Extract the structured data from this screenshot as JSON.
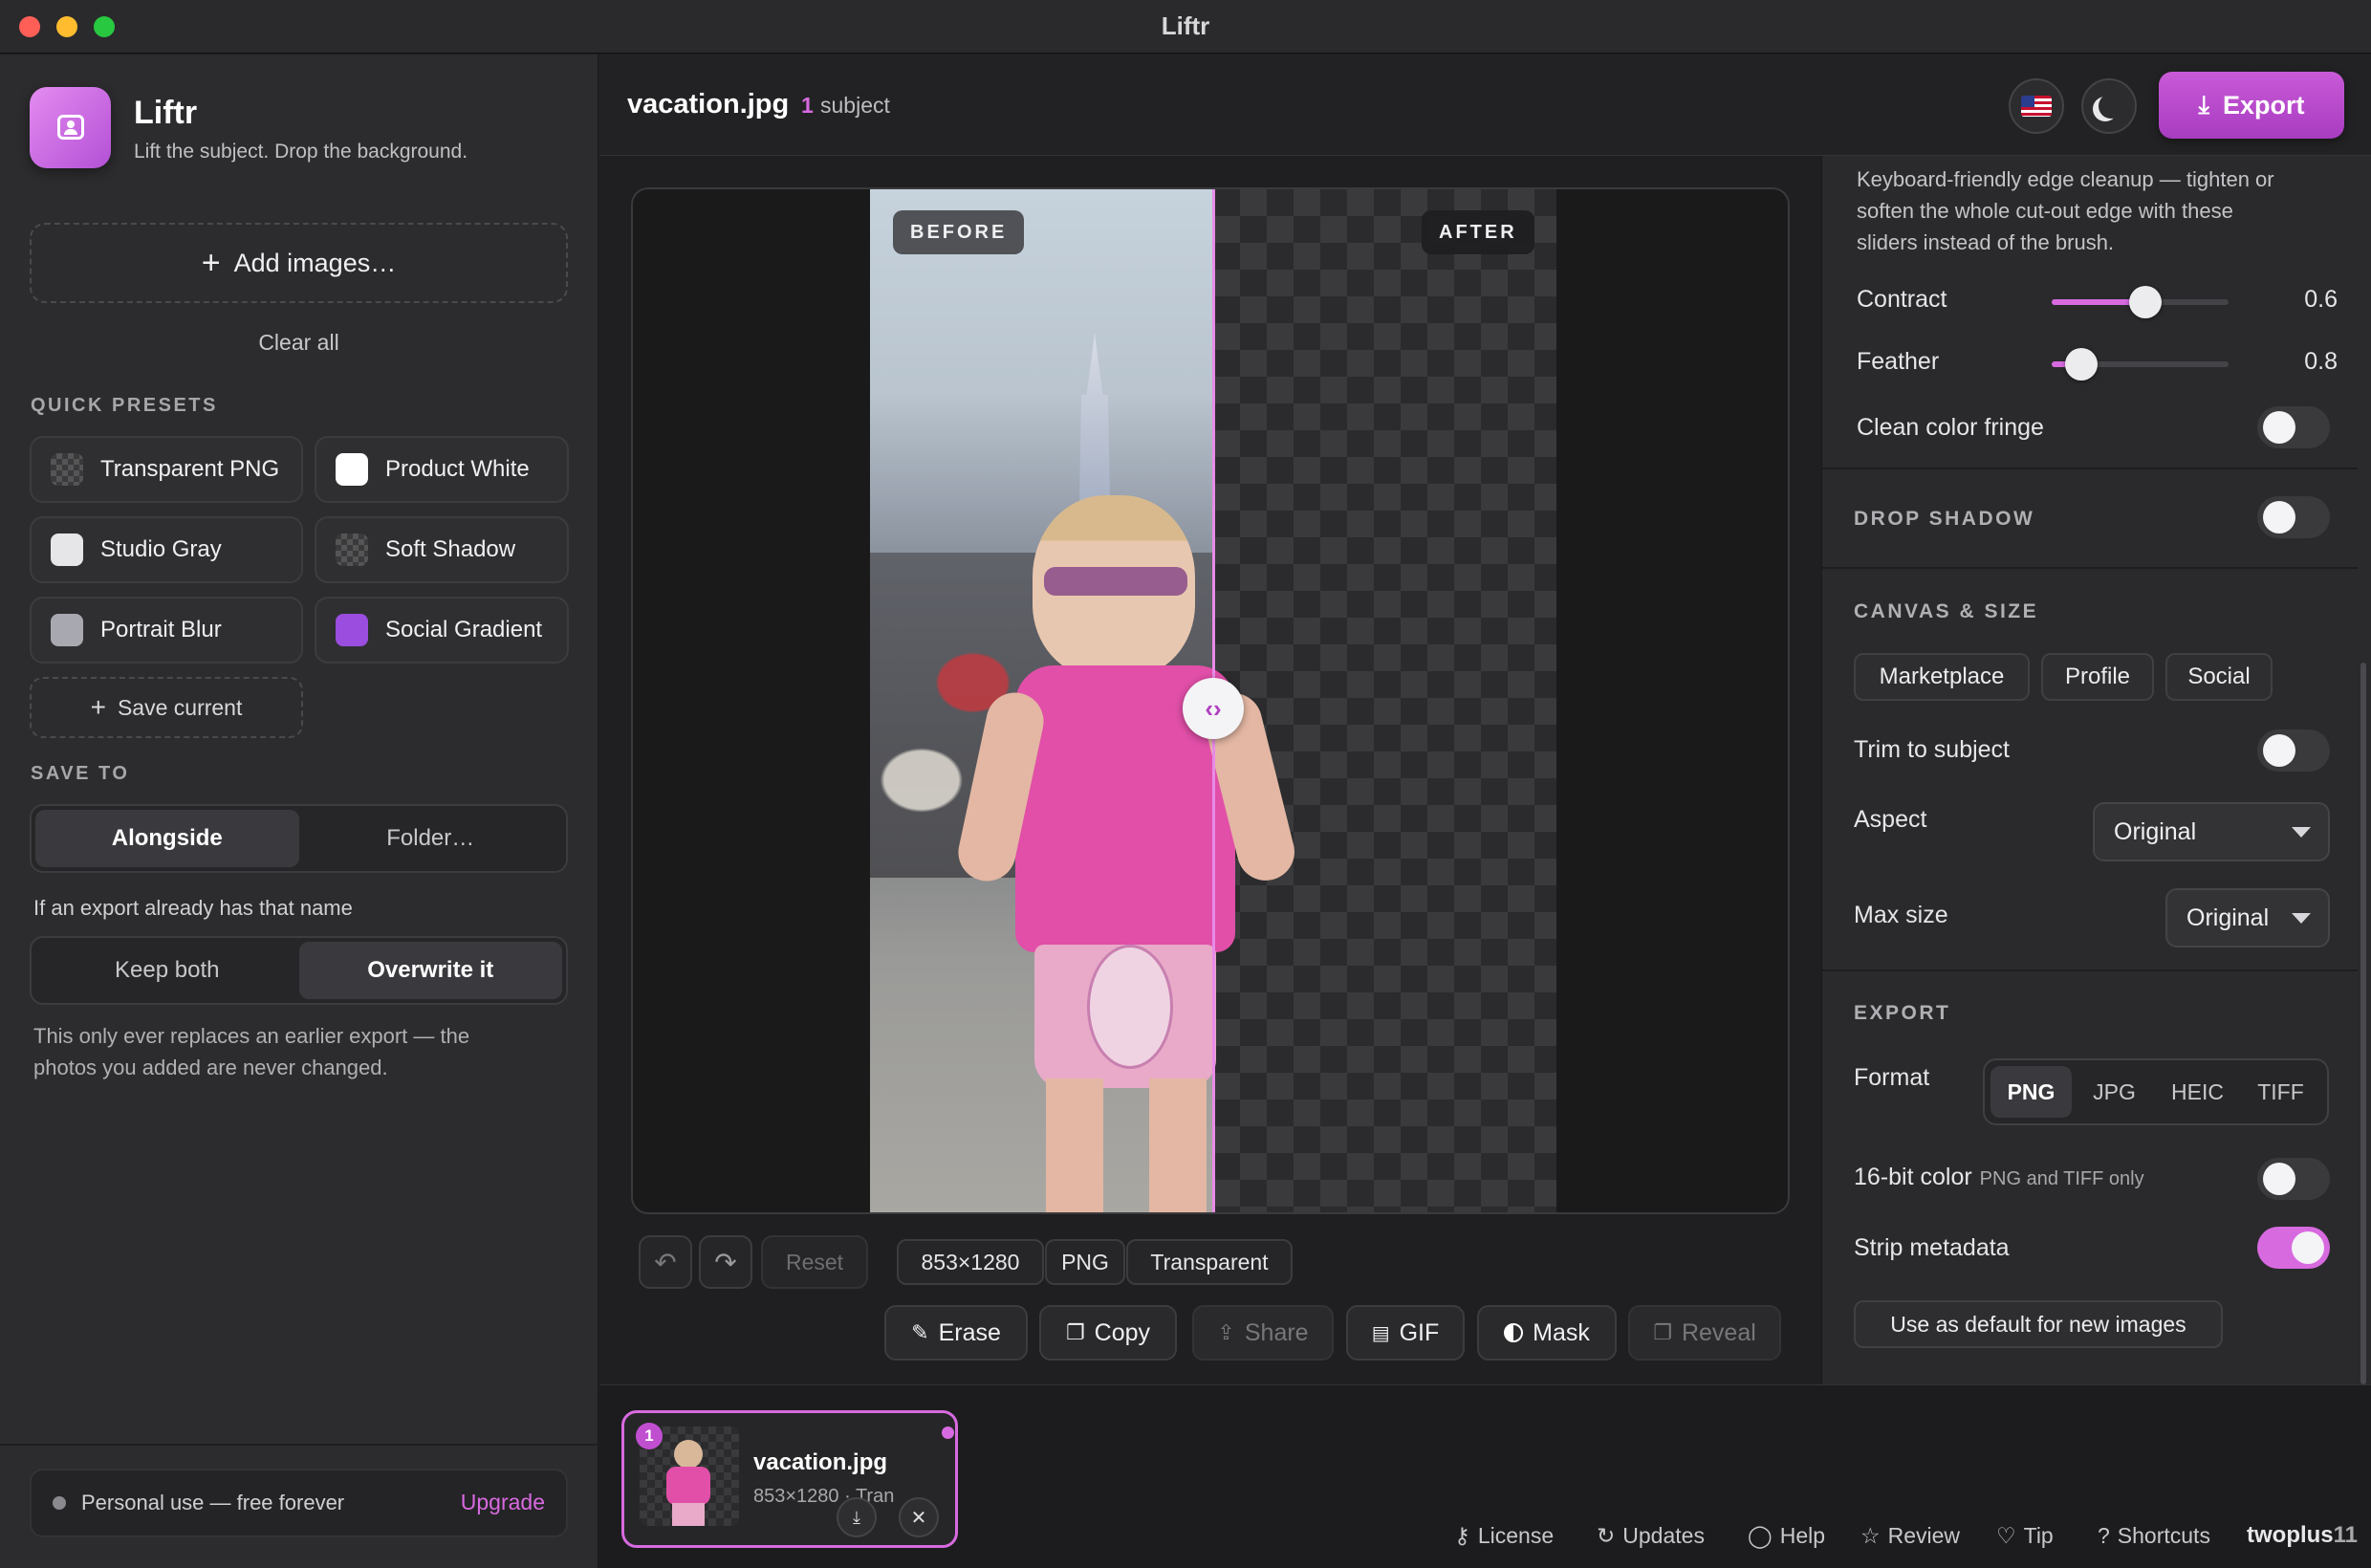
{
  "window": {
    "title": "Liftr"
  },
  "sidebar": {
    "app_name": "Liftr",
    "tagline": "Lift the subject. Drop the background.",
    "add_images": "Add images…",
    "clear_all": "Clear all",
    "quick_presets_label": "QUICK PRESETS",
    "presets": [
      {
        "label": "Transparent PNG",
        "swatch": "checker"
      },
      {
        "label": "Product White",
        "swatch": "#ffffff"
      },
      {
        "label": "Studio Gray",
        "swatch": "#e6e6e8"
      },
      {
        "label": "Soft Shadow",
        "swatch": "checker"
      },
      {
        "label": "Portrait Blur",
        "swatch": "#a8a8b0"
      },
      {
        "label": "Social Gradient",
        "swatch": "#9b4de0"
      }
    ],
    "save_current": "Save current",
    "save_to_label": "SAVE TO",
    "save_to": {
      "alongside": "Alongside",
      "folder": "Folder…",
      "selected": "Alongside"
    },
    "conflict_label": "If an export already has that name",
    "conflict": {
      "keep_both": "Keep both",
      "overwrite": "Overwrite it",
      "selected": "Overwrite it"
    },
    "conflict_note_1": "This only ever replaces an earlier export — the",
    "conflict_note_2": "photos you added are never changed.",
    "license_text": "Personal use — free forever",
    "upgrade": "Upgrade"
  },
  "topbar": {
    "filename": "vacation.jpg",
    "subject_count": "1",
    "subject_label": "subject",
    "flag_icon": "us-flag",
    "theme_icon": "moon-icon",
    "export_label": "Export"
  },
  "preview": {
    "before_label": "BEFORE",
    "after_label": "AFTER"
  },
  "toolbar": {
    "reset": "Reset",
    "dimensions": "853×1280",
    "format": "PNG",
    "background": "Transparent",
    "erase": "Erase",
    "copy": "Copy",
    "share": "Share",
    "gif": "GIF",
    "mask": "Mask",
    "reveal": "Reveal"
  },
  "panel": {
    "edge_note_1": "Keyboard-friendly edge cleanup — tighten or",
    "edge_note_2": "soften the whole cut-out edge with these",
    "edge_note_3": "sliders instead of the brush.",
    "contract_label": "Contract",
    "contract_value": "0.6",
    "contract_level": 0.53,
    "feather_label": "Feather",
    "feather_value": "0.8",
    "feather_level": 0.17,
    "fringe_label": "Clean color fringe",
    "fringe_on": false,
    "drop_shadow_head": "DROP SHADOW",
    "drop_shadow_on": false,
    "canvas_head": "CANVAS & SIZE",
    "canvas_chips": [
      "Marketplace",
      "Profile",
      "Social"
    ],
    "trim_label": "Trim to subject",
    "trim_on": false,
    "aspect_label": "Aspect",
    "aspect_value": "Original",
    "maxsize_label": "Max size",
    "maxsize_value": "Original",
    "export_head": "EXPORT",
    "format_label": "Format",
    "formats": [
      "PNG",
      "JPG",
      "HEIC",
      "TIFF"
    ],
    "format_selected": "PNG",
    "bit_label": "16-bit color",
    "bit_note": "PNG and TIFF only",
    "bit_on": false,
    "strip_label": "Strip metadata",
    "strip_on": true,
    "default_button": "Use as default for new images"
  },
  "strip": {
    "thumb_index": "1",
    "thumb_name": "vacation.jpg",
    "thumb_meta": "853×1280 · Tran"
  },
  "footer": {
    "license": "License",
    "updates": "Updates",
    "help": "Help",
    "review": "Review",
    "tip": "Tip",
    "shortcuts": "Shortcuts",
    "brand_a": "twoplus",
    "brand_b": "11"
  },
  "colors": {
    "accent": "#c04fd0",
    "accent_light": "#d86ae0"
  }
}
